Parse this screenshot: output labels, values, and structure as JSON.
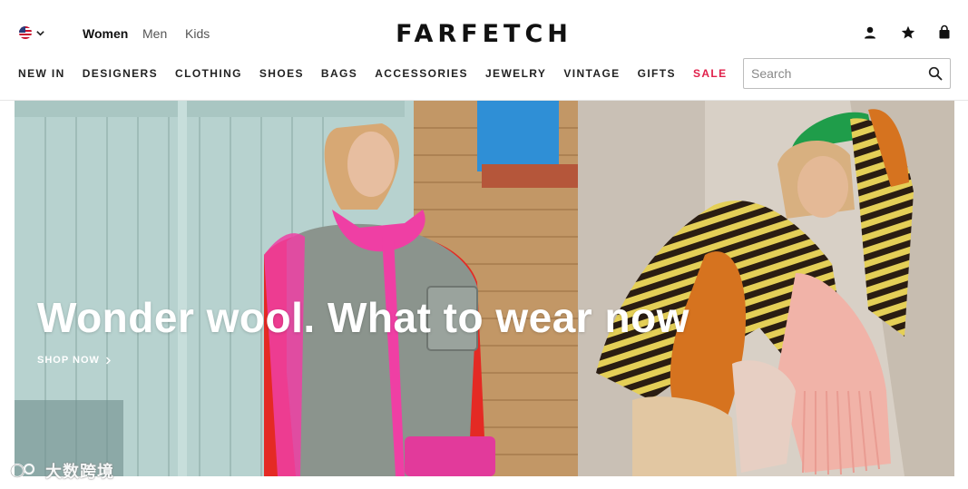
{
  "header": {
    "locale_flag": "us-flag-icon",
    "gender_tabs": [
      {
        "label": "Women",
        "active": true
      },
      {
        "label": "Men",
        "active": false
      },
      {
        "label": "Kids",
        "active": false
      }
    ],
    "logo": "FARFETCH",
    "icons": [
      "account-icon",
      "wishlist-star-icon",
      "shopping-bag-icon"
    ]
  },
  "nav": {
    "items": [
      {
        "label": "NEW IN"
      },
      {
        "label": "DESIGNERS"
      },
      {
        "label": "CLOTHING"
      },
      {
        "label": "SHOES"
      },
      {
        "label": "BAGS"
      },
      {
        "label": "ACCESSORIES"
      },
      {
        "label": "JEWELRY"
      },
      {
        "label": "VINTAGE"
      },
      {
        "label": "GIFTS"
      },
      {
        "label": "SALE",
        "highlight": true
      }
    ]
  },
  "search": {
    "placeholder": "Search",
    "value": ""
  },
  "hero": {
    "headline": "Wonder wool. What to wear now",
    "cta": "SHOP NOW"
  },
  "watermark": {
    "text": "大数跨境"
  },
  "colors": {
    "sale": "#e0204a",
    "text": "#222222",
    "hero_text": "#ffffff",
    "wall_blue": "#b9d3d0",
    "pink": "#ef3fa4",
    "orange": "#d6731f"
  }
}
